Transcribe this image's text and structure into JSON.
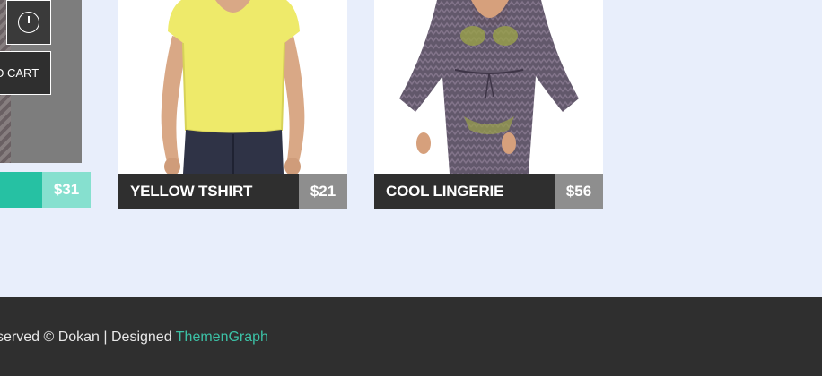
{
  "products": [
    {
      "price": "$31",
      "add_to_cart_label": "D CART"
    },
    {
      "name": "YELLOW TSHIRT",
      "price": "$21"
    },
    {
      "name": "COOL LINGERIE",
      "price": "$56"
    }
  ],
  "footer": {
    "copyright_text": "served © Dokan | Designed ",
    "designer_link": "ThemenGraph"
  },
  "colors": {
    "accent": "#26c1a3",
    "footer_bg": "#2f2f2f",
    "page_bg": "#e8eefb",
    "link": "#3cc1a6"
  }
}
